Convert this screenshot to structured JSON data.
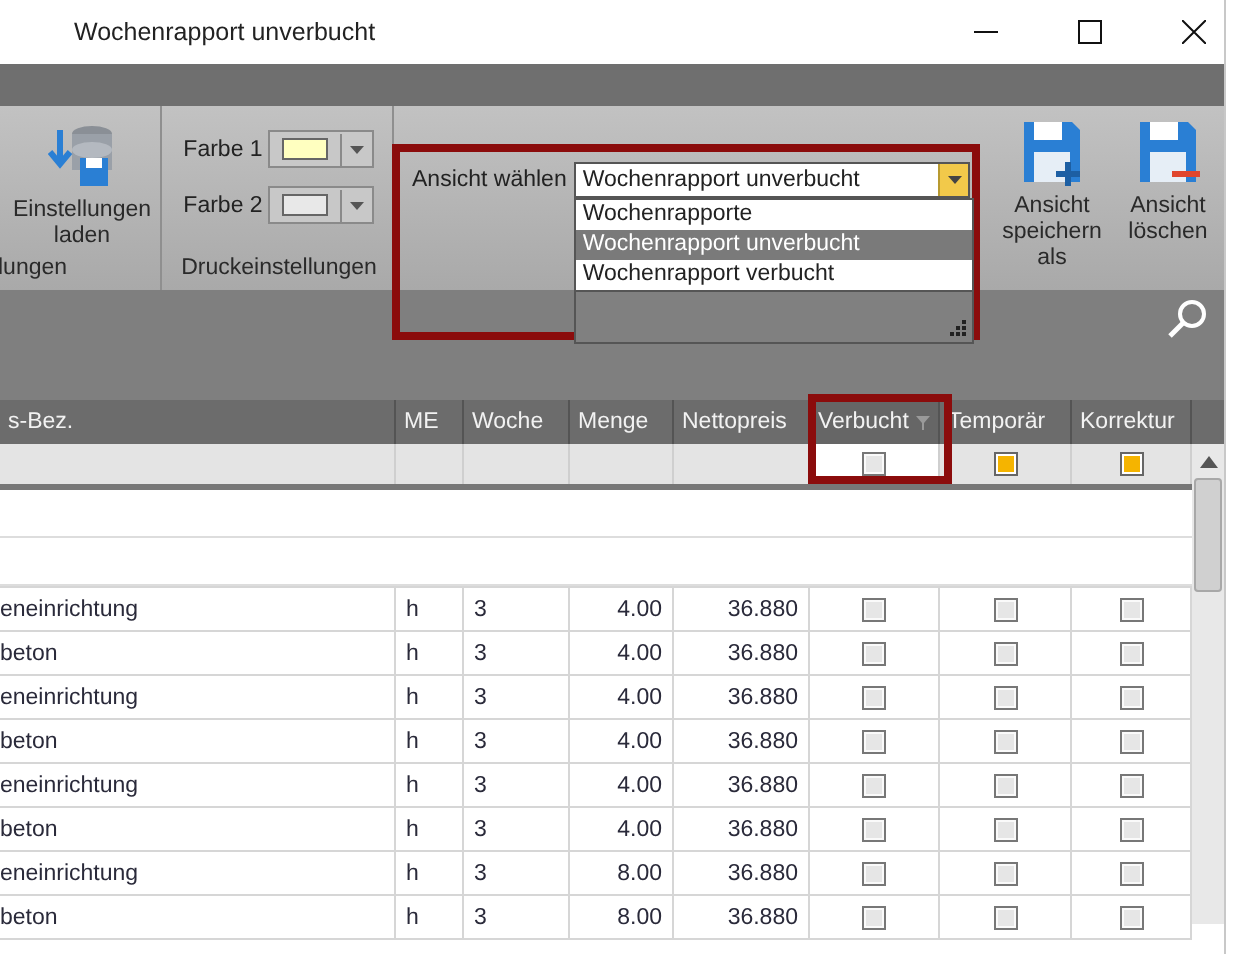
{
  "window": {
    "title": "Wochenrapport unverbucht"
  },
  "ribbon": {
    "load_group": {
      "button": "Einstellungen laden",
      "group_label": "lungen"
    },
    "print_group": {
      "colors": [
        {
          "label": "Farbe 1",
          "color": "#ffffc0"
        },
        {
          "label": "Farbe 2",
          "color": "#e8e8e8"
        }
      ],
      "group_label": "Druckeinstellungen"
    },
    "view": {
      "label": "Ansicht wählen",
      "value": "Wochenrapport unverbucht",
      "highlighted": true,
      "expanded": true,
      "options": [
        {
          "label": "Wochenrapporte",
          "selected": false
        },
        {
          "label": "Wochenrapport unverbucht",
          "selected": true
        },
        {
          "label": "Wochenrapport verbucht",
          "selected": false
        }
      ]
    },
    "view_buttons": [
      {
        "label": "Ansicht speichern als",
        "kind": "save-add"
      },
      {
        "label": "Ansicht löschen",
        "kind": "save-delete"
      }
    ]
  },
  "table": {
    "columns": [
      {
        "label": "s-Bez.",
        "highlighted": false,
        "filter": false
      },
      {
        "label": "ME",
        "highlighted": false,
        "filter": false
      },
      {
        "label": "Woche",
        "highlighted": false,
        "filter": false
      },
      {
        "label": "Menge",
        "highlighted": false,
        "filter": false
      },
      {
        "label": "Nettopreis",
        "highlighted": false,
        "filter": false
      },
      {
        "label": "Verbucht",
        "highlighted": true,
        "filter": true
      },
      {
        "label": "Temporär",
        "highlighted": false,
        "filter": false
      },
      {
        "label": "Korrektur",
        "highlighted": false,
        "filter": false
      }
    ],
    "filter_row": [
      {
        "kind": "empty"
      },
      {
        "kind": "empty"
      },
      {
        "kind": "empty"
      },
      {
        "kind": "empty"
      },
      {
        "kind": "empty"
      },
      {
        "kind": "checkbox",
        "indeterminate": false
      },
      {
        "kind": "checkbox",
        "indeterminate": true
      },
      {
        "kind": "checkbox",
        "indeterminate": true
      }
    ],
    "rows": [
      {
        "cells": [
          "eneinrichtung",
          "h",
          "3",
          "4.00",
          "36.880"
        ],
        "checks": [
          false,
          false,
          false
        ]
      },
      {
        "cells": [
          "beton",
          "h",
          "3",
          "4.00",
          "36.880"
        ],
        "checks": [
          false,
          false,
          false
        ]
      },
      {
        "cells": [
          "eneinrichtung",
          "h",
          "3",
          "4.00",
          "36.880"
        ],
        "checks": [
          false,
          false,
          false
        ]
      },
      {
        "cells": [
          "beton",
          "h",
          "3",
          "4.00",
          "36.880"
        ],
        "checks": [
          false,
          false,
          false
        ]
      },
      {
        "cells": [
          "eneinrichtung",
          "h",
          "3",
          "4.00",
          "36.880"
        ],
        "checks": [
          false,
          false,
          false
        ]
      },
      {
        "cells": [
          "beton",
          "h",
          "3",
          "4.00",
          "36.880"
        ],
        "checks": [
          false,
          false,
          false
        ]
      },
      {
        "cells": [
          "eneinrichtung",
          "h",
          "3",
          "8.00",
          "36.880"
        ],
        "checks": [
          false,
          false,
          false
        ]
      },
      {
        "cells": [
          "beton",
          "h",
          "3",
          "8.00",
          "36.880"
        ],
        "checks": [
          false,
          false,
          false
        ]
      }
    ]
  }
}
